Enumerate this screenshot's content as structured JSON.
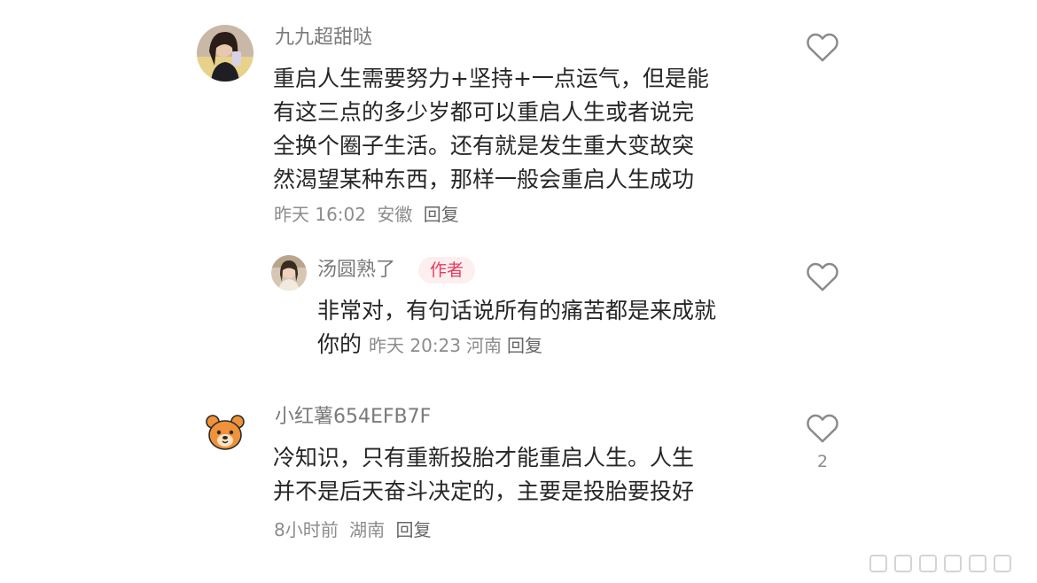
{
  "comments": [
    {
      "username": "九九超甜哒",
      "lines": [
        "重启人生需要努力+坚持+一点运气，但是能",
        "有这三点的多少岁都可以重启人生或者说完",
        "全换个圈子生活。还有就是发生重大变故突",
        "然渴望某种东西，那样一般会重启人生成功"
      ],
      "time": "昨天 16:02",
      "location": "安徽",
      "reply_label": "回复",
      "reply": {
        "username": "汤圆熟了",
        "author_tag": "作者",
        "lines": [
          "非常对，有句话说所有的痛苦都是来成就",
          "你的"
        ],
        "time": "昨天 20:23",
        "location": "河南",
        "reply_label": "回复"
      }
    },
    {
      "username": "小红薯654EFB7F",
      "lines": [
        "冷知识，只有重新投胎才能重启人生。人生",
        "并不是后天奋斗决定的，主要是投胎要投好"
      ],
      "time": "8小时前",
      "location": "湖南",
      "reply_label": "回复",
      "like_count": "2"
    }
  ],
  "icons": {
    "like": "heart-outline-icon",
    "avatar_default": "bear-avatar-icon",
    "watermark": "weibo-watermark"
  },
  "colors": {
    "author_tag_bg": "#fdeef0",
    "author_tag_text": "#e83a5a",
    "meta_text": "#8c8c8c",
    "username_text": "#7a7a7a",
    "bear_orange": "#f0923a"
  }
}
